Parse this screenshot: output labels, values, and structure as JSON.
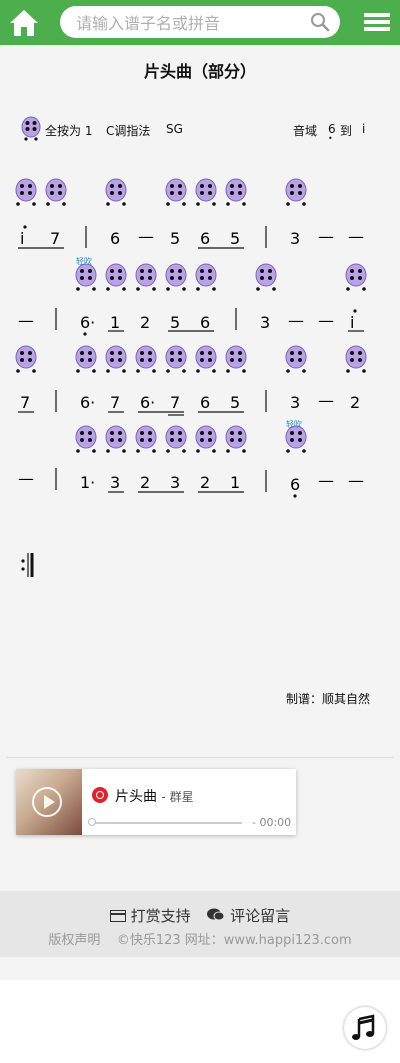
{
  "header": {
    "search_placeholder": "请输入谱子名或拼音"
  },
  "score": {
    "title": "片头曲（部分）",
    "fingering": "全按为 1",
    "key": "C调指法",
    "instrument": "SG",
    "range_label": "音域",
    "range_low": "6",
    "range_to": "到",
    "range_high": "i",
    "credit": "制谱：顺其自然",
    "breath_mark": "轻吹",
    "lines": [
      {
        "notes": [
          "i",
          "7",
          "|",
          "6",
          "—",
          "5",
          "6",
          "5",
          "|",
          "3",
          "—",
          "—"
        ]
      },
      {
        "notes": [
          "—",
          "|",
          "6·",
          "1",
          "2",
          "5",
          "6",
          "|",
          "3",
          "—",
          "—",
          "i"
        ]
      },
      {
        "notes": [
          "7",
          "|",
          "6·",
          "7",
          "6·",
          "7",
          "6",
          "5",
          "|",
          "3",
          "—",
          "2"
        ]
      },
      {
        "notes": [
          "—",
          "|",
          "1·",
          "3",
          "2",
          "3",
          "2",
          "1",
          "|",
          "6",
          "—",
          "—"
        ]
      }
    ]
  },
  "player": {
    "song_title": "片头曲",
    "artist": "- 群星",
    "time": "- 00:00"
  },
  "footer": {
    "reward": "打赏支持",
    "comment": "评论留言",
    "copyright": "版权声明",
    "site": "©快乐123 网址：www.happi123.com"
  },
  "colors": {
    "brand_green": "#4cae4c",
    "ocarina_purple": "#b9a3e6",
    "breath_blue": "#1a8fd1"
  }
}
